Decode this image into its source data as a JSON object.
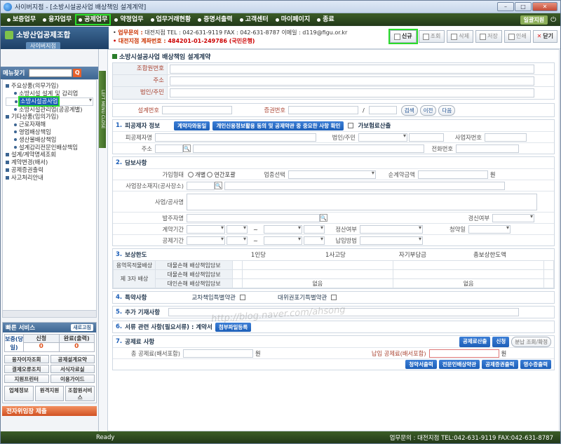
{
  "window": {
    "title": "사이버지점 - [소방시설공사업 배상책임 설계계약]"
  },
  "topmenu": [
    {
      "label": "보증업무",
      "active": false
    },
    {
      "label": "융자업무",
      "active": false
    },
    {
      "label": "공제업무",
      "active": true
    },
    {
      "label": "약정업무",
      "active": false
    },
    {
      "label": "업무거래현황",
      "active": false
    },
    {
      "label": "증명서출력",
      "active": false
    },
    {
      "label": "고객센터",
      "active": false
    },
    {
      "label": "마이페이지",
      "active": false
    },
    {
      "label": "종료",
      "active": false
    }
  ],
  "topmenu_right": {
    "badge": "일괄지원",
    "power": "⏻"
  },
  "logo": {
    "name": "소방산업공제조합",
    "sub": "사이버지점"
  },
  "info": {
    "line1_label": "업무문의 :",
    "line1_text": "대전지점  TEL : 042-631-9119  FAX : 042-631-8787  이메일 : d119@figu.or.kr",
    "line2_label": "대전지점 계좌번호 :",
    "line2_text": "484201-01-249786 (국민은행)"
  },
  "toolbar": {
    "new": "신규",
    "search": "조회",
    "delete": "삭제",
    "save": "저장",
    "print": "인쇄",
    "close": "닫기"
  },
  "sidebar": {
    "find_label": "메뉴찾기",
    "items": [
      {
        "level": 1,
        "label": "주요상품(의무가입)"
      },
      {
        "level": 2,
        "label": "소방시설 설계 및 감리업"
      },
      {
        "level": 2,
        "label": "소방시설공사업",
        "selected": true
      },
      {
        "level": 2,
        "label": "소방시설관리업(공공계별)"
      },
      {
        "level": 1,
        "label": "기타상품(임의가입)"
      },
      {
        "level": 2,
        "label": "근로자재해"
      },
      {
        "level": 2,
        "label": "영업배상책임"
      },
      {
        "level": 2,
        "label": "생산물배상책임"
      },
      {
        "level": 2,
        "label": "설계감리전문인배상책임"
      },
      {
        "level": 1,
        "label": "설계/계약명세조회"
      },
      {
        "level": 1,
        "label": "계약변경(배서)"
      },
      {
        "level": 1,
        "label": "공제증권출력"
      },
      {
        "level": 1,
        "label": "사고처리안내"
      }
    ],
    "tab_strip": "LEFT MENU CLOSE"
  },
  "services": {
    "title": "빠른 서비스",
    "refresh": "새로고침",
    "status_label": "보증(당일)",
    "col1_head": "신청",
    "col1_val": "0",
    "col2_head": "완료(출력)",
    "col2_val": "0",
    "buttons": [
      "융자이자조회",
      "공제설계요약",
      "결제오류조치",
      "서식자료실",
      "지원프린터",
      "이용가이드"
    ],
    "icons": [
      "업체정보",
      "원격지원",
      "조합원서비스"
    ],
    "submit": "전자위임장 제출"
  },
  "main": {
    "title": "소방시설공사업 배상책임 설계계약",
    "member_labels": [
      "조합원번호",
      "주소",
      "법인/주민"
    ],
    "design_no_label": "설계번호",
    "policy_no_label": "증권번호",
    "slash": "/",
    "btn_search": "검색",
    "btn_prev": "이전",
    "btn_next": "다음",
    "sec1": {
      "num": "1.",
      "title": "피공제자 정보",
      "btn_agree": "계약자와동일",
      "btn_privacy": "개인신용정보활용 동의 및 공제약관 중 중요한 사항 확인",
      "check_label": "가보험료산출",
      "insured_name": "피공제자명",
      "corp_label": "법인/주민",
      "biz_label": "사업자번호",
      "addr_label": "주소",
      "phone_label": "전화번호"
    },
    "sec2": {
      "num": "2.",
      "title": "담보사항",
      "join_type": "가입형태",
      "opt1": "개별",
      "opt2": "연간포괄",
      "industry": "업종선택",
      "net_amount": "순계약금액",
      "won": "원",
      "site_addr": "사업장소재지(공사장소)",
      "project": "사업/공사명",
      "client": "발주자명",
      "bid": "경신여부",
      "contract_period": "계약기간",
      "settle": "정산여부",
      "subscribe": "청약일",
      "coverage_period": "공제기간",
      "payment": "납입방법",
      "tilde": "~"
    },
    "sec3": {
      "num": "3.",
      "title": "보상한도",
      "headers": [
        "1인당",
        "1사고당",
        "자기부담금",
        "총보상한도액"
      ],
      "rows": [
        {
          "group": "용역목적물배상",
          "label": "대물손해 배상책임담보"
        },
        {
          "group": "제 3자 배상",
          "label": "대물손해 배상책임담보"
        },
        {
          "group": "",
          "label": "대인손해 배상책임담보"
        }
      ],
      "none1": "없음",
      "none2": "없음"
    },
    "sec4": {
      "num": "4.",
      "title": "특약사항",
      "opt1": "교차책임특별약관",
      "opt2": "대위권포기특별약관"
    },
    "sec5": {
      "num": "5.",
      "title": "추가 기재사항"
    },
    "sec6": {
      "num": "6.",
      "title": "서류 관련 사항(필요서류) : 계약서",
      "btn": "첨부파일등록"
    },
    "sec7": {
      "num": "7.",
      "title": "공제료 사항",
      "btn_calc": "공제료산출",
      "btn_apply": "신청",
      "btn_split": "분납 조회/확정",
      "total_label": "총 공제료(배서포함)",
      "paid_label": "납입 공제료(배서포함)",
      "won": "원",
      "actions": [
        "청약서출력",
        "전문인배상약관",
        "공제증권출력",
        "영수증출력"
      ]
    }
  },
  "status": {
    "ready": "Ready",
    "contact": "업무문의 : 대전지점  TEL:042-631-9119  FAX:042-631-8787"
  },
  "watermark": "http://blog.naver.com/ahsong",
  "colors": {
    "accent_green": "#2bdc2b",
    "menu_bg": "#2e4a1e",
    "primary_blue": "#1d5fb8"
  }
}
